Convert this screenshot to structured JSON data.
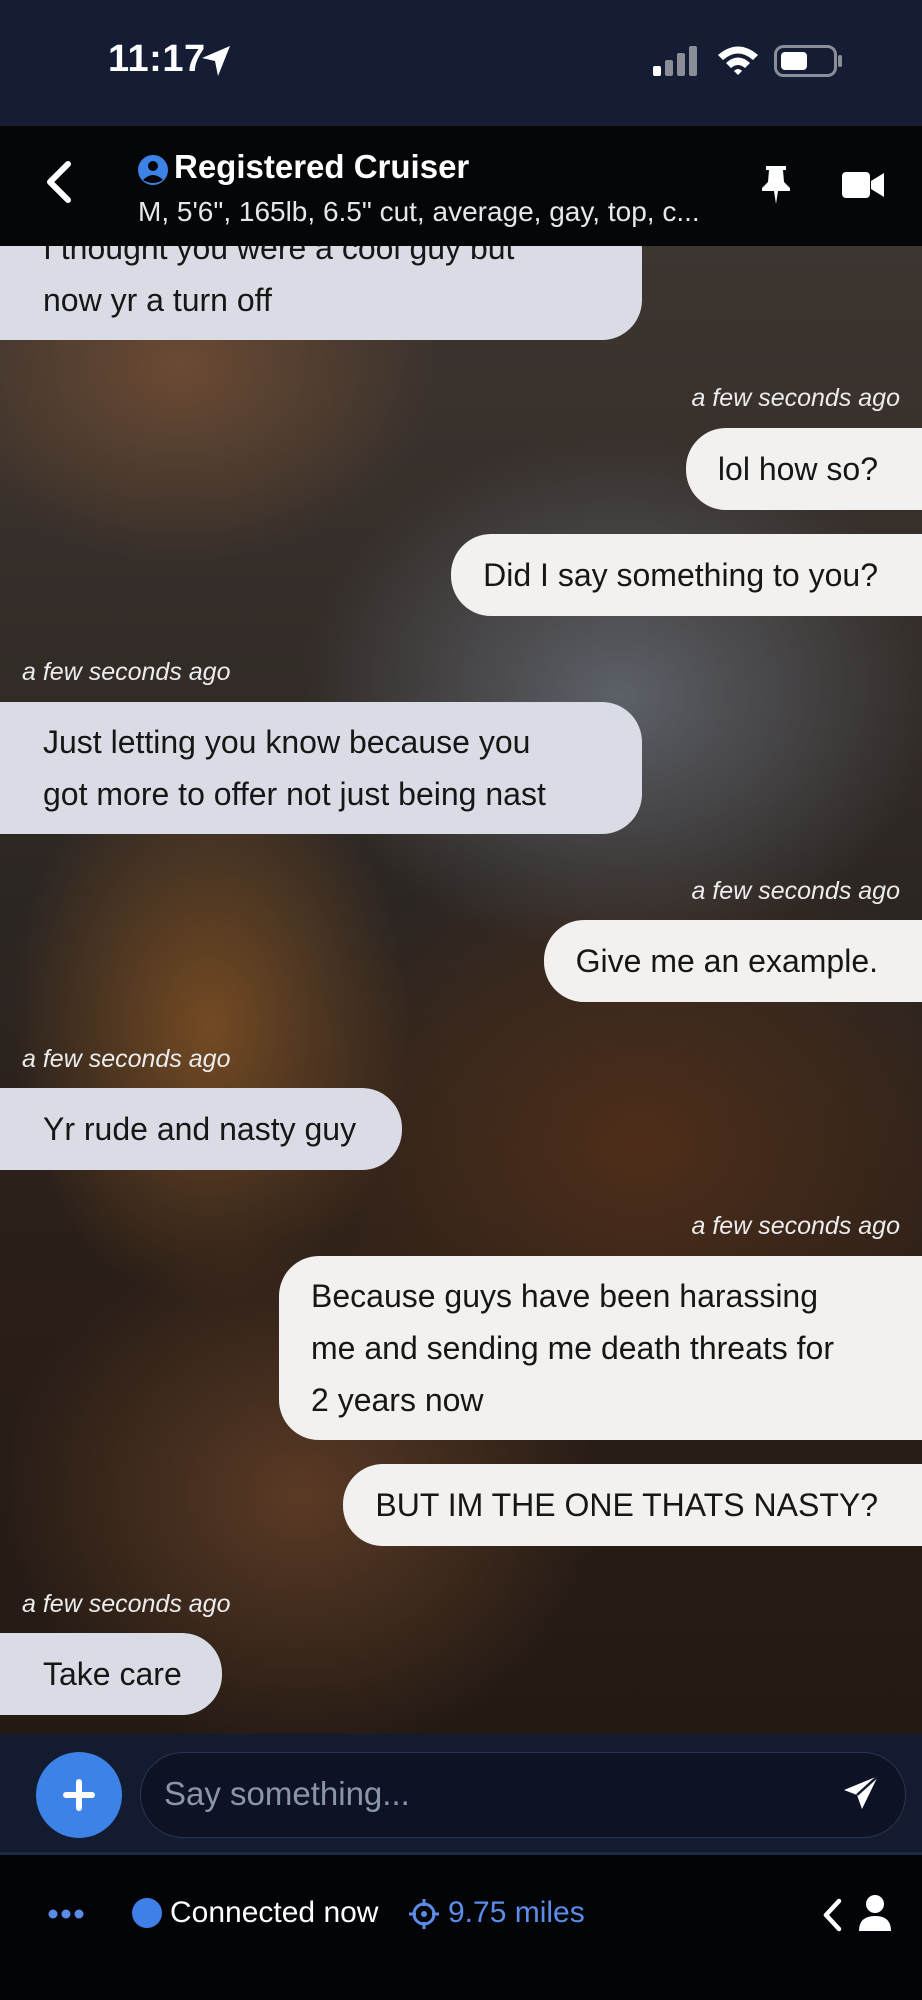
{
  "status_bar": {
    "time": "11:17",
    "icons": [
      "location-arrow-icon",
      "cellular-signal-icon",
      "wifi-icon",
      "battery-icon"
    ]
  },
  "header": {
    "title": "Registered Cruiser",
    "subtitle": "M, 5'6\", 165lb, 6.5\" cut, average, gay, top, c...",
    "icons": [
      "back-chevron-icon",
      "user-circle-icon",
      "pin-icon",
      "video-camera-icon"
    ]
  },
  "messages": [
    {
      "direction": "in",
      "lines": [
        "I thought you were a cool guy but",
        "now yr a turn off"
      ]
    },
    {
      "timestamp": "a few seconds ago",
      "direction": "out",
      "lines": [
        "lol how so?"
      ]
    },
    {
      "direction": "out",
      "lines": [
        "Did I say something to you?"
      ]
    },
    {
      "timestamp": "a few seconds ago",
      "direction": "in",
      "lines": [
        "Just letting you know because you",
        "got more to offer not just being nast"
      ]
    },
    {
      "timestamp": "a few seconds ago",
      "direction": "out",
      "lines": [
        "Give me an example."
      ]
    },
    {
      "timestamp": "a few seconds ago",
      "direction": "in",
      "lines": [
        "Yr rude and nasty guy"
      ]
    },
    {
      "timestamp": "a few seconds ago",
      "direction": "out",
      "lines": [
        "Because guys have been harassing",
        "me and sending me death threats for",
        "2 years now"
      ]
    },
    {
      "direction": "out",
      "lines": [
        "BUT IM THE ONE THATS NASTY?"
      ]
    },
    {
      "timestamp": "a few seconds ago",
      "direction": "in",
      "lines": [
        "Take care"
      ]
    }
  ],
  "composer": {
    "placeholder": "Say something...",
    "icons": [
      "plus-icon",
      "send-icon"
    ]
  },
  "footer": {
    "status": "Connected now",
    "distance": "9.75 miles",
    "icons": [
      "more-dots-icon",
      "online-dot-icon",
      "location-target-icon",
      "chevron-left-icon",
      "person-icon"
    ]
  },
  "colors": {
    "status_bar_bg": "#141d33",
    "header_bg": "#050608",
    "incoming_bubble": "#d9dce5",
    "outgoing_bubble": "#f2f1ef",
    "accent": "#3d82e6",
    "distance_text": "#5b8de8"
  }
}
